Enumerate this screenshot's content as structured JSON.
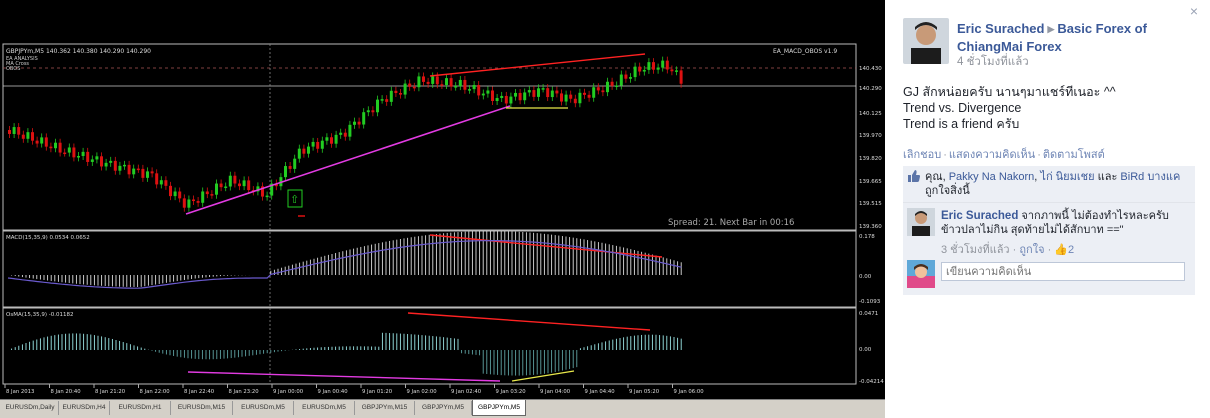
{
  "chart": {
    "symbol_header": "GBPJPYm,M5",
    "ohlc": "140.362 140.380 140.290 140.290",
    "indicator_name": "EA_MACD_OBOS v1.9",
    "overlay_lines": [
      "EA ANALYSIS",
      "MA Cross",
      "OBOS"
    ],
    "spread_text": "Spread: 21. Next Bar in 00:16",
    "price_axis": [
      "140.430",
      "140.290",
      "140.125",
      "139.970",
      "139.820",
      "139.665",
      "139.515",
      "139.360"
    ],
    "macd_label": "MACD(15,35,9) 0.0534 0.0652",
    "macd_axis": [
      "0.178",
      "0.00",
      "-0.1093"
    ],
    "osma_label": "OsMA(15,35,9) -0.01182",
    "osma_axis": [
      "0.0471",
      "0.00",
      "-0.04214"
    ],
    "time_axis": [
      "8 Jan 2013",
      "8 Jan 20:40",
      "8 Jan 21:20",
      "8 Jan 22:00",
      "8 Jan 22:40",
      "8 Jan 23:20",
      "9 Jan 00:00",
      "9 Jan 00:40",
      "9 Jan 01:20",
      "9 Jan 02:00",
      "9 Jan 02:40",
      "9 Jan 03:20",
      "9 Jan 04:00",
      "9 Jan 04:40",
      "9 Jan 05:20",
      "9 Jan 06:00"
    ],
    "up_arrow_glyph": "⇧",
    "colors": {
      "bull": "#22cc22",
      "bear": "#dd1111",
      "trend": "#e23be2",
      "divergence": "#ff2222",
      "support": "#e8e84a",
      "macd_signal": "#6a5acd"
    }
  },
  "tabs": [
    "EURUSDm,Daily",
    "EURUSDm,H4",
    "EURUSDm,H1",
    "EURUSDm,M15",
    "EURUSDm,M5",
    "EURUSDm,M5",
    "GBPJPYm,M15",
    "GBPJPYm,M5",
    "GBPJPYm,M5"
  ],
  "active_tab": 8,
  "post": {
    "close_glyph": "×",
    "author": "Eric Surached",
    "arrow_glyph": "▶",
    "group": "Basic Forex of ChiangMai Forex",
    "time": "4 ชั่วโมงที่แล้ว",
    "lines": [
      "GJ สักหน่อยครับ นานๆมาแชร์ทีเนอะ ^^",
      "Trend vs. Divergence",
      "Trend is a friend ครับ"
    ],
    "actions": [
      "เลิกชอบ",
      "แสดงความคิดเห็น",
      "ติดตามโพสต์"
    ],
    "likes": {
      "prefix": "คุณ,",
      "names": [
        "Pakky Na Nakorn",
        "ไก่ นิยมเชย"
      ],
      "and": "และ",
      "last": "BiRd บางแค",
      "suffix": "ถูกใจสิ่งนี้"
    },
    "comment": {
      "author": "Eric Surached",
      "text": "จากภาพนี้ ไม่ต้องทำไรหละครับ ข้าวปลาไม่กิน สุดท้ายไม่ได้สักบาท ==\"",
      "time": "3 ชั่วโมงที่แล้ว",
      "like_label": "ถูกใจ",
      "like_count": "2"
    },
    "write_placeholder": "เขียนความคิดเห็น"
  }
}
